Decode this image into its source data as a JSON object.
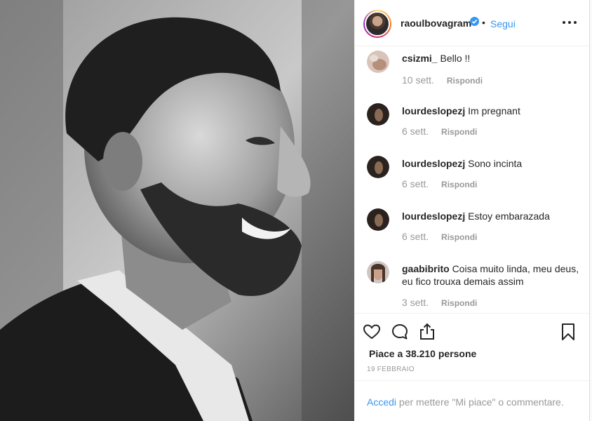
{
  "post": {
    "username": "raoulbovagram",
    "verified": true,
    "separator": "•",
    "follow_label": "Segui",
    "more_icon": "ellipsis-icon"
  },
  "comments": [
    {
      "username": "csizmi_",
      "text": "Bello !!",
      "time": "10 sett.",
      "reply": "Rispondi"
    },
    {
      "username": "lourdeslopezj",
      "text": "Im pregnant",
      "time": "6 sett.",
      "reply": "Rispondi"
    },
    {
      "username": "lourdeslopezj",
      "text": "Sono incinta",
      "time": "6 sett.",
      "reply": "Rispondi"
    },
    {
      "username": "lourdeslopezj",
      "text": "Estoy embarazada",
      "time": "6 sett.",
      "reply": "Rispondi"
    },
    {
      "username": "gaabibrito",
      "text": "Coisa muito linda, meu deus, eu fico trouxa demais assim",
      "time": "3 sett.",
      "reply": "Rispondi"
    }
  ],
  "actions": {
    "likes_text": "Piace a 38.210 persone",
    "date": "19 FEBBRAIO"
  },
  "login": {
    "link": "Accedi",
    "rest": " per mettere \"Mi piace\" o commentare."
  },
  "colors": {
    "link": "#3897f0",
    "muted": "#999999",
    "text": "#262626"
  }
}
